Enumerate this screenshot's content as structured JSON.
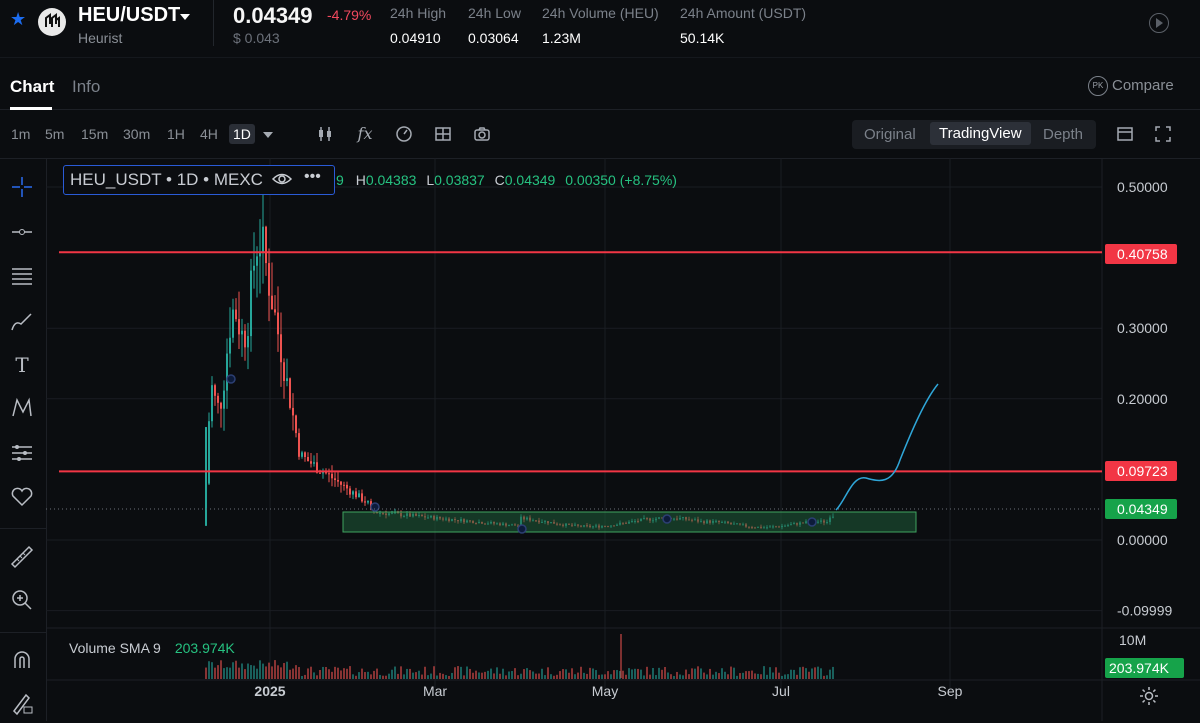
{
  "header": {
    "pair": "HEU/USDT",
    "name": "Heurist",
    "price": "0.04349",
    "change_pct": "-4.79%",
    "usd_price": "$ 0.043",
    "stats": [
      {
        "label": "24h High",
        "value": "0.04910"
      },
      {
        "label": "24h Low",
        "value": "0.03064"
      },
      {
        "label": "24h Volume (HEU)",
        "value": "1.23M"
      },
      {
        "label": "24h Amount (USDT)",
        "value": "50.14K"
      }
    ]
  },
  "tabs": {
    "chart": "Chart",
    "info": "Info",
    "compare": "Compare",
    "compare_badge": "PK"
  },
  "toolbar": {
    "intervals": [
      "1m",
      "5m",
      "15m",
      "30m",
      "1H",
      "4H",
      "1D"
    ],
    "active_interval": "1D",
    "views": [
      "Original",
      "TradingView",
      "Depth"
    ],
    "active_view": "TradingView"
  },
  "legend": {
    "title": "HEU_USDT • 1D • MEXC",
    "o_tail": "9",
    "h_label": "H",
    "h": "0.04383",
    "l_label": "L",
    "l": "0.03837",
    "c_label": "C",
    "c": "0.04349",
    "change": "0.00350 (+8.75%)",
    "volume_label": "Volume SMA 9",
    "volume_value": "203.974K"
  },
  "chart_data": {
    "type": "line",
    "y_ticks": [
      "0.50000",
      "0.30000",
      "0.20000",
      "0.00000",
      "-0.09999"
    ],
    "x_ticks": [
      "2025",
      "Mar",
      "May",
      "Jul",
      "Sep"
    ],
    "volume_ticks": [
      "10M"
    ],
    "horizontal_lines": [
      0.40758,
      0.09723
    ],
    "last_price": 0.04349,
    "price_labels": [
      "0.40758",
      "0.09723",
      "0.04349"
    ],
    "volume_last": "203.974K",
    "ylim": [
      -0.1,
      0.5
    ],
    "colors": {
      "up": "#26a69a",
      "down": "#ef5350",
      "line": "#f23645",
      "projection": "#2fa6d8",
      "zone": "#1f5c38"
    }
  }
}
